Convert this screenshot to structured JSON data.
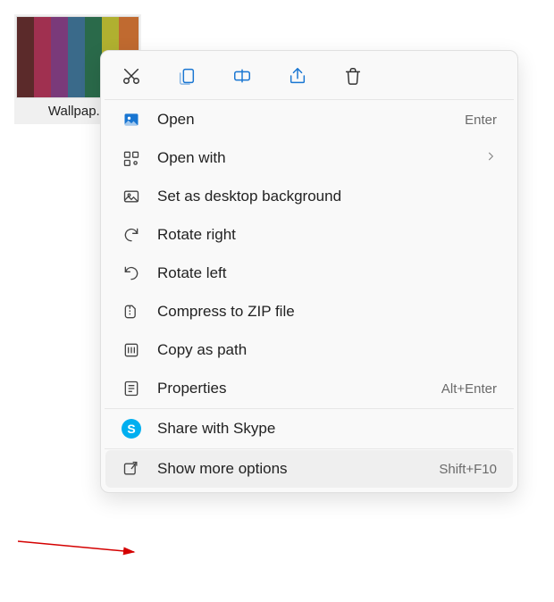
{
  "file": {
    "label": "Wallpap..."
  },
  "toolbar": {
    "cut": "cut-icon",
    "copy": "copy-icon",
    "rename": "rename-icon",
    "share": "share-icon",
    "delete": "delete-icon"
  },
  "items": [
    {
      "icon": "picture-icon",
      "label": "Open",
      "shortcut": "Enter",
      "hasSub": false
    },
    {
      "icon": "openwith-icon",
      "label": "Open with",
      "shortcut": "",
      "hasSub": true
    },
    {
      "icon": "wallpaper-icon",
      "label": "Set as desktop background",
      "shortcut": "",
      "hasSub": false
    },
    {
      "icon": "rotate-right-icon",
      "label": "Rotate right",
      "shortcut": "",
      "hasSub": false
    },
    {
      "icon": "rotate-left-icon",
      "label": "Rotate left",
      "shortcut": "",
      "hasSub": false
    },
    {
      "icon": "zip-icon",
      "label": "Compress to ZIP file",
      "shortcut": "",
      "hasSub": false
    },
    {
      "icon": "copy-path-icon",
      "label": "Copy as path",
      "shortcut": "",
      "hasSub": false
    },
    {
      "icon": "properties-icon",
      "label": "Properties",
      "shortcut": "Alt+Enter",
      "hasSub": false
    }
  ],
  "skype": {
    "label": "Share with Skype"
  },
  "more": {
    "label": "Show more options",
    "shortcut": "Shift+F10"
  }
}
